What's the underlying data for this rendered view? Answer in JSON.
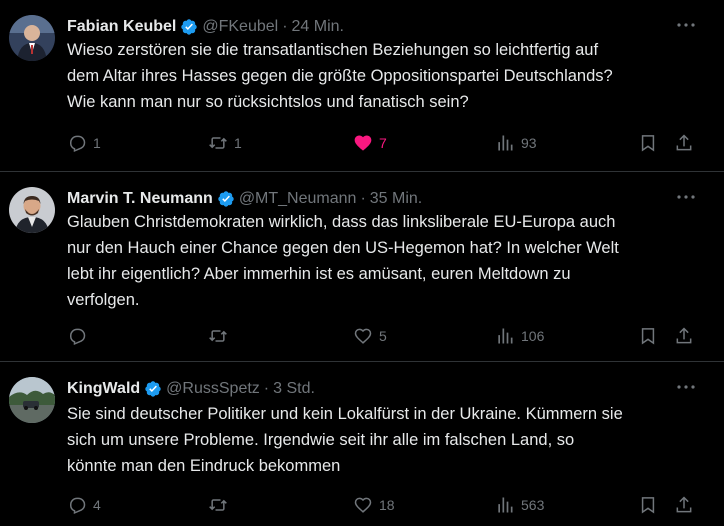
{
  "tweets": [
    {
      "name": "Fabian Keubel",
      "handle": "@FKeubel",
      "separator": "·",
      "time": "24 Min.",
      "lines": [
        "Wieso zerstören sie die transatlantischen Beziehungen so leichtfertig auf",
        "dem Altar ihres Hasses gegen die größte Oppositionspartei Deutschlands?",
        "Wie kann man nur so rücksichtslos und fanatisch sein?"
      ],
      "replies": "1",
      "reposts": "1",
      "likes": "7",
      "liked": true,
      "views": "93"
    },
    {
      "name": "Marvin T. Neumann",
      "handle": "@MT_Neumann",
      "separator": "·",
      "time": "35 Min.",
      "lines": [
        "Glauben Christdemokraten wirklich, dass das linksliberale EU-Europa auch",
        "nur den Hauch einer Chance gegen den US-Hegemon hat? In welcher Welt",
        "lebt ihr eigentlich? Aber immerhin ist es amüsant, euren Meltdown zu",
        "verfolgen."
      ],
      "replies": "",
      "reposts": "",
      "likes": "5",
      "liked": false,
      "views": "106"
    },
    {
      "name": "KingWald",
      "handle": "@RussSpetz",
      "separator": "·",
      "time": "3 Std.",
      "lines": [
        "Sie sind deutscher Politiker und kein Lokalfürst in der Ukraine. Kümmern sie",
        "sich um unsere Probleme. Irgendwie seit ihr alle im falschen Land, so",
        "könnte man den Eindruck bekommen"
      ],
      "replies": "4",
      "reposts": "",
      "likes": "18",
      "liked": false,
      "views": "563"
    }
  ],
  "colors": {
    "background": "#000000",
    "text": "#e7e9ea",
    "muted": "#71767b",
    "verified": "#1d9bf0",
    "like": "#f91880",
    "divider": "#2f3336"
  }
}
